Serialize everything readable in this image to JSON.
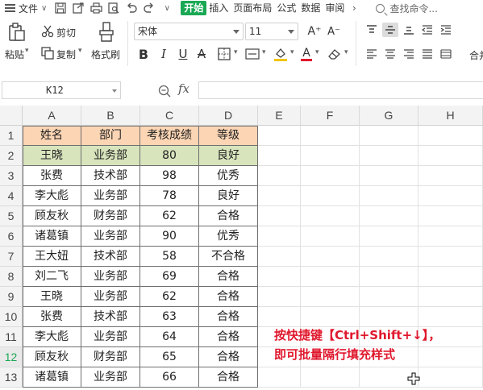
{
  "menu": {
    "file_label": "文件",
    "tabs": [
      "开始",
      "插入",
      "页面布局",
      "公式",
      "数据",
      "审阅"
    ],
    "active_tab_index": 0,
    "search_placeholder": "查找命令..."
  },
  "ribbon": {
    "cut_label": "剪切",
    "paste_label": "粘贴",
    "copy_label": "复制",
    "format_painter_label": "格式刷",
    "font_name": "宋体",
    "font_size": "11",
    "merge_label": "合并",
    "font_color": "#e0182d",
    "fill_color": "#f2c500"
  },
  "formula_bar": {
    "name_box": "K12",
    "fx_label": "fx",
    "formula": ""
  },
  "sheet": {
    "columns": [
      "A",
      "B",
      "C",
      "D",
      "E",
      "F",
      "G",
      "H"
    ],
    "row_numbers": [
      "1",
      "2",
      "3",
      "4",
      "5",
      "6",
      "7",
      "8",
      "9",
      "10",
      "11",
      "12",
      "13"
    ],
    "active_row": "12",
    "header": [
      "姓名",
      "部门",
      "考核成绩",
      "等级"
    ],
    "rows": [
      [
        "王晓",
        "业务部",
        "80",
        "良好"
      ],
      [
        "张费",
        "技术部",
        "98",
        "优秀"
      ],
      [
        "李大彪",
        "业务部",
        "78",
        "良好"
      ],
      [
        "顾友秋",
        "财务部",
        "62",
        "合格"
      ],
      [
        "诸葛镇",
        "业务部",
        "90",
        "优秀"
      ],
      [
        "王大妞",
        "技术部",
        "58",
        "不合格"
      ],
      [
        "刘二飞",
        "业务部",
        "69",
        "合格"
      ],
      [
        "王晓",
        "业务部",
        "62",
        "合格"
      ],
      [
        "张费",
        "技术部",
        "63",
        "合格"
      ],
      [
        "李大彪",
        "业务部",
        "64",
        "合格"
      ],
      [
        "顾友秋",
        "财务部",
        "65",
        "合格"
      ],
      [
        "诸葛镇",
        "业务部",
        "66",
        "合格"
      ]
    ],
    "header_fill": "#fcd5b4",
    "highlight_fill": "#d8e4bc"
  },
  "annotation": {
    "line1": "按快捷键【Ctrl+Shift+↓】，",
    "line2": "即可批量隔行填充样式",
    "color": "#e0182d"
  }
}
